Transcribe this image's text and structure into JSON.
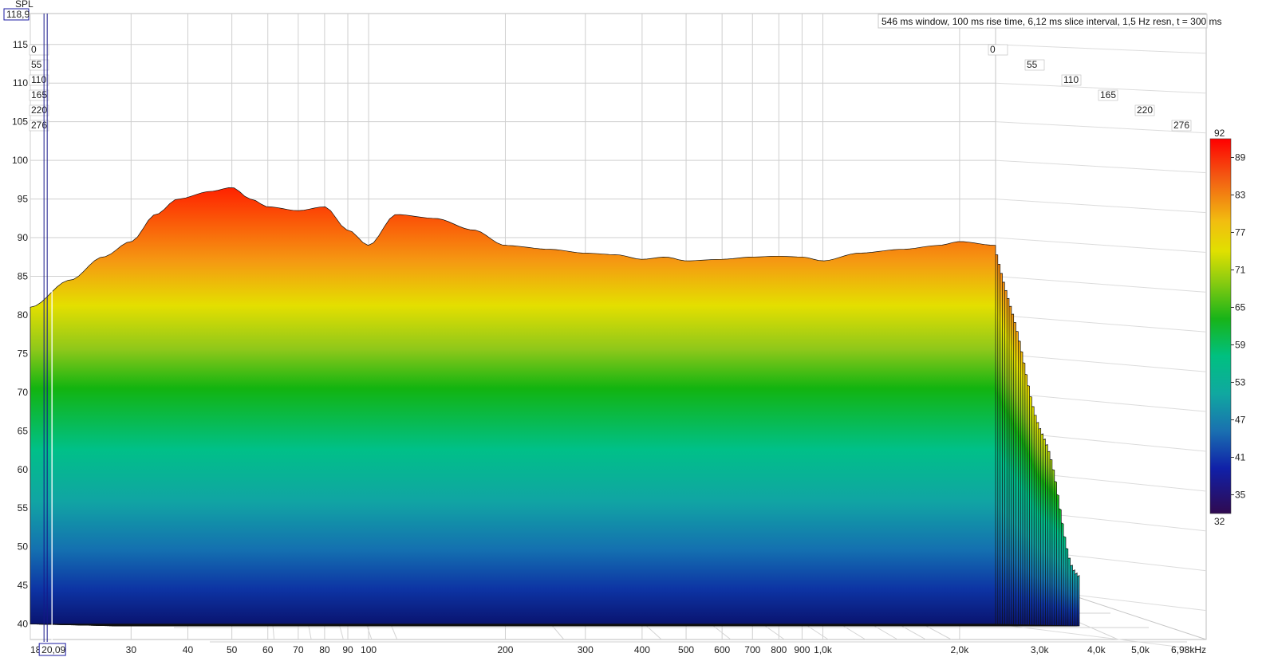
{
  "chart_data": {
    "type": "waterfall",
    "ylabel": "SPL",
    "cursor": {
      "spl": "118,9",
      "freq": "20,09",
      "freq_value": 20.09
    },
    "info": "546 ms window, 100 ms rise time, 6,12 ms slice interval, 1,5 Hz resn, t = 300 ms",
    "ylim": [
      38,
      119
    ],
    "y_ticks": [
      115,
      110,
      105,
      100,
      95,
      90,
      85,
      80,
      75,
      70,
      65,
      60,
      55,
      50,
      45,
      40
    ],
    "x_range_hz": [
      18,
      6980
    ],
    "x_ticks": [
      {
        "label": "18",
        "hz": 18
      },
      {
        "label": "30",
        "hz": 30
      },
      {
        "label": "40",
        "hz": 40
      },
      {
        "label": "50",
        "hz": 50
      },
      {
        "label": "60",
        "hz": 60
      },
      {
        "label": "70",
        "hz": 70
      },
      {
        "label": "80",
        "hz": 80
      },
      {
        "label": "90",
        "hz": 90
      },
      {
        "label": "100",
        "hz": 100
      },
      {
        "label": "200",
        "hz": 200
      },
      {
        "label": "300",
        "hz": 300
      },
      {
        "label": "400",
        "hz": 400
      },
      {
        "label": "500",
        "hz": 500
      },
      {
        "label": "600",
        "hz": 600
      },
      {
        "label": "700",
        "hz": 700
      },
      {
        "label": "800",
        "hz": 800
      },
      {
        "label": "900",
        "hz": 900
      },
      {
        "label": "1,0k",
        "hz": 1000
      },
      {
        "label": "2,0k",
        "hz": 2000
      },
      {
        "label": "3,0k",
        "hz": 3000
      },
      {
        "label": "4,0k",
        "hz": 4000
      },
      {
        "label": "5,0k",
        "hz": 5000
      },
      {
        "label": "6,98kHz",
        "hz": 6980
      }
    ],
    "time_ticks_ms": [
      "0",
      "55",
      "110",
      "165",
      "220",
      "276"
    ],
    "colorbar": {
      "min": "32",
      "max": "92",
      "ticks": [
        "89",
        "83",
        "77",
        "71",
        "65",
        "59",
        "53",
        "47",
        "41",
        "35"
      ]
    },
    "front_slice_spl": [
      [
        18,
        81
      ],
      [
        22,
        84.5
      ],
      [
        26,
        87.5
      ],
      [
        30,
        89.5
      ],
      [
        34,
        93
      ],
      [
        38,
        95
      ],
      [
        45,
        96
      ],
      [
        50,
        96.5
      ],
      [
        55,
        95
      ],
      [
        60,
        94
      ],
      [
        70,
        93.5
      ],
      [
        80,
        94
      ],
      [
        90,
        91
      ],
      [
        100,
        89
      ],
      [
        115,
        93
      ],
      [
        140,
        92.5
      ],
      [
        170,
        91
      ],
      [
        200,
        89
      ],
      [
        250,
        88.5
      ],
      [
        300,
        88
      ],
      [
        350,
        87.8
      ],
      [
        400,
        87.2
      ],
      [
        450,
        87.5
      ],
      [
        500,
        87
      ],
      [
        600,
        87.2
      ],
      [
        700,
        87.5
      ],
      [
        800,
        87.6
      ],
      [
        900,
        87.5
      ],
      [
        1000,
        87
      ],
      [
        1200,
        88
      ],
      [
        1500,
        88.5
      ],
      [
        1800,
        89
      ],
      [
        2000,
        89.5
      ],
      [
        2400,
        89
      ]
    ]
  }
}
